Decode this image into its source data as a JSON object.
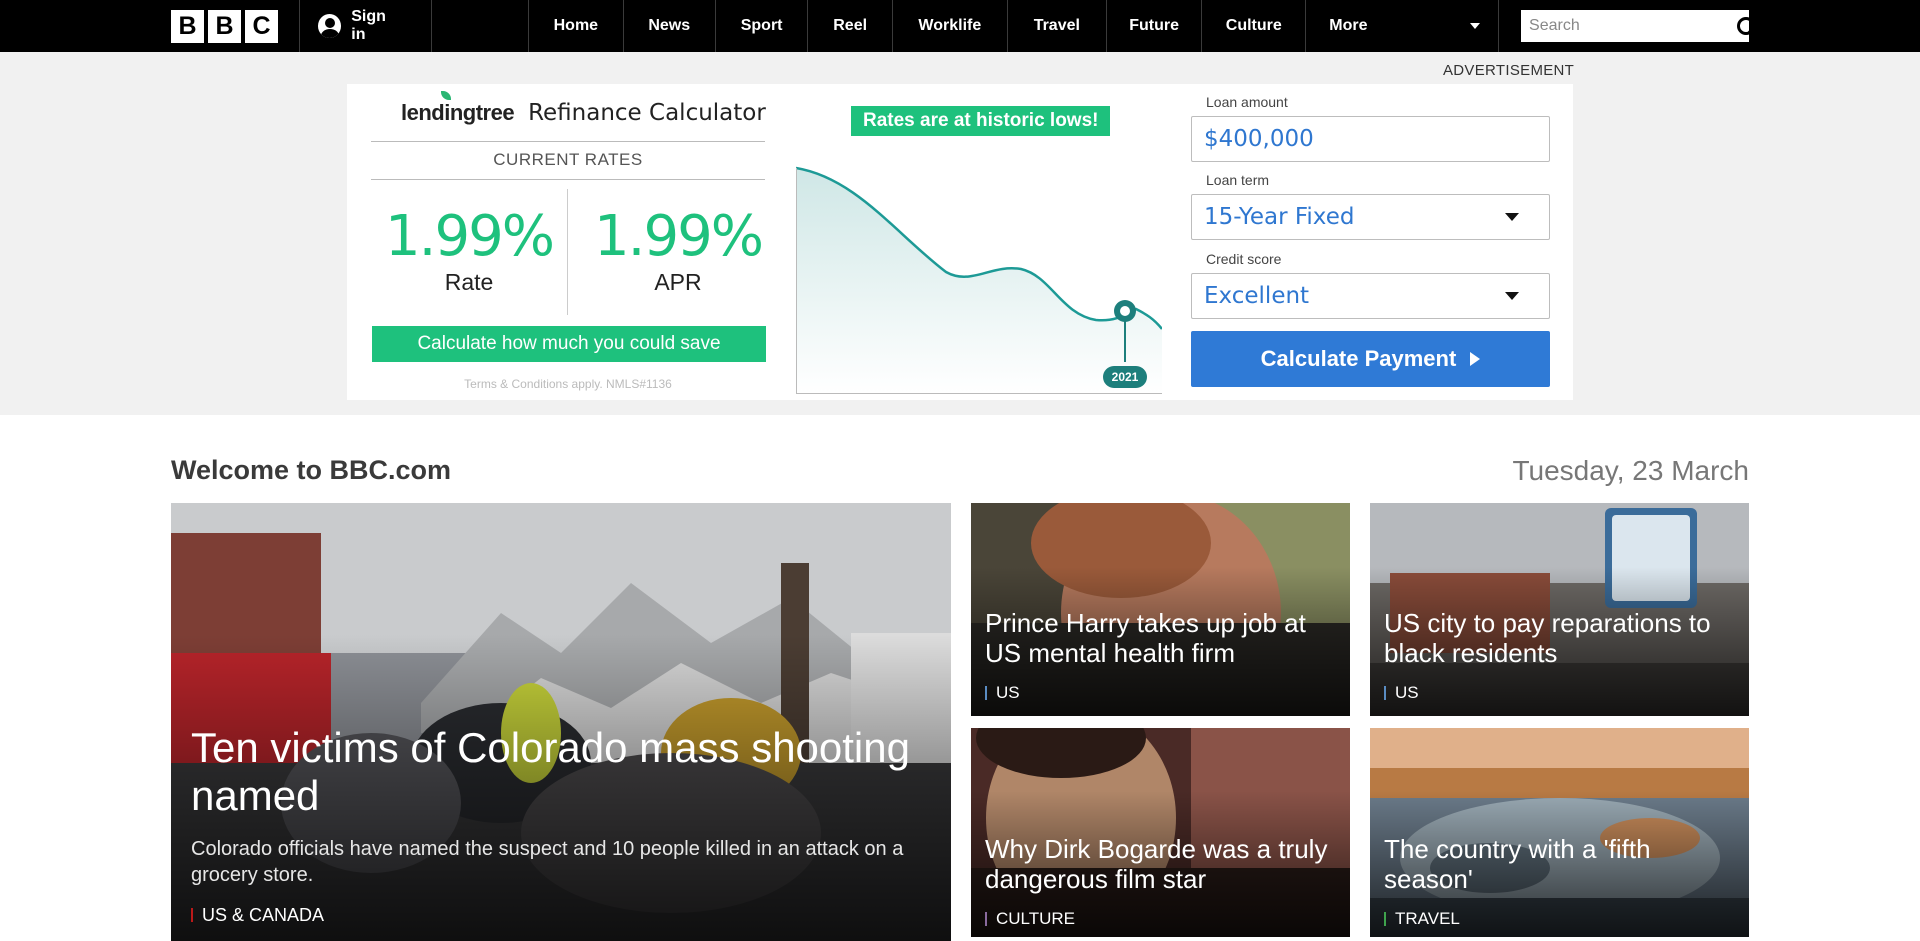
{
  "nav": {
    "logo_letters": [
      "B",
      "B",
      "C"
    ],
    "signin_label": "Sign in",
    "links": [
      {
        "label": "Home",
        "width": 97
      },
      {
        "label": "News",
        "width": 95
      },
      {
        "label": "Sport",
        "width": 95
      },
      {
        "label": "Reel",
        "width": 87
      },
      {
        "label": "Worklife",
        "width": 118
      },
      {
        "label": "Travel",
        "width": 102
      },
      {
        "label": "Future",
        "width": 98
      },
      {
        "label": "Culture",
        "width": 107
      }
    ],
    "more_label": "More",
    "search_placeholder": "Search"
  },
  "ad": {
    "label": "ADVERTISEMENT",
    "brand": "lendingtree",
    "title": "Refinance Calculator",
    "current_rates_label": "CURRENT RATES",
    "rate_value": "1.99%",
    "rate_label": "Rate",
    "apr_value": "1.99%",
    "apr_label": "APR",
    "cta": "Calculate how much you could save",
    "terms": "Terms & Conditions apply. NMLS#1136",
    "headline": "Rates are at historic lows!",
    "year_badge": "2021",
    "loan_amount_label": "Loan amount",
    "loan_amount_value": "$400,000",
    "loan_term_label": "Loan term",
    "loan_term_value": "15-Year Fixed",
    "credit_label": "Credit score",
    "credit_value": "Excellent",
    "calc_button": "Calculate Payment",
    "accent_green": "#1ec17d",
    "accent_blue": "#2f7ad6"
  },
  "main": {
    "welcome": "Welcome to BBC.com",
    "date": "Tuesday, 23 March",
    "lead": {
      "headline": "Ten victims of Colorado mass shooting named",
      "summary": "Colorado officials have named the suspect and 10 people killed in an attack on a grocery store.",
      "tag": "US & CANADA",
      "tag_color": "#bb1919"
    },
    "cards": [
      {
        "headline": "Prince Harry takes up job at US mental health firm",
        "tag": "US",
        "tag_color": "#5a8cc2"
      },
      {
        "headline": "US city to pay reparations to black residents",
        "tag": "US",
        "tag_color": "#5a8cc2"
      },
      {
        "headline": "Why Dirk Bogarde was a truly dangerous film star",
        "tag": "CULTURE",
        "tag_color": "#8a6a9e"
      },
      {
        "headline": "The country with a 'fifth season'",
        "tag": "TRAVEL",
        "tag_color": "#3fa34d"
      }
    ]
  }
}
